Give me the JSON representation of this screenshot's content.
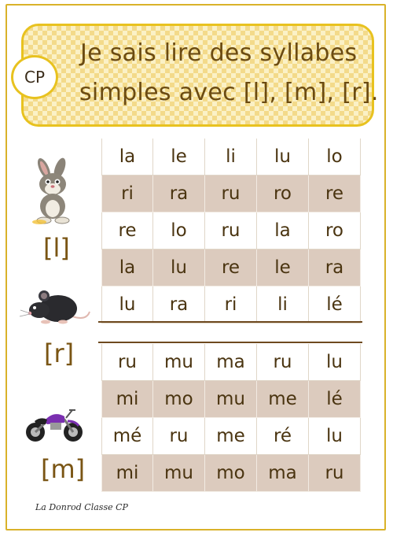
{
  "badge": "CP",
  "title": {
    "line1": "Je sais lire des syllabes",
    "line2": "simples avec [l], [m], [r]."
  },
  "labels": {
    "l": "[l]",
    "r": "[r]",
    "m": "[m]"
  },
  "table_top": {
    "rows": [
      [
        "la",
        "le",
        "li",
        "lu",
        "lo"
      ],
      [
        "ri",
        "ra",
        "ru",
        "ro",
        "re"
      ],
      [
        "re",
        "lo",
        "ru",
        "la",
        "ro"
      ],
      [
        "la",
        "lu",
        "re",
        "le",
        "ra"
      ],
      [
        "lu",
        "ra",
        "ri",
        "li",
        "lé"
      ]
    ]
  },
  "table_bottom": {
    "rows": [
      [
        "ru",
        "mu",
        "ma",
        "ru",
        "lu"
      ],
      [
        "mi",
        "mo",
        "mu",
        "me",
        "lé"
      ],
      [
        "mé",
        "ru",
        "me",
        "ré",
        "lu"
      ],
      [
        "mi",
        "mu",
        "mo",
        "ma",
        "ru"
      ]
    ]
  },
  "footer": "La Donrod Classe CP",
  "colors": {
    "title_border": "#e8c21f",
    "title_text": "#6b4b12",
    "shaded_row": "#dccbbe",
    "frame": "#d9b22a"
  },
  "icons": [
    "rabbit-icon",
    "rat-icon",
    "motorcycle-icon"
  ]
}
